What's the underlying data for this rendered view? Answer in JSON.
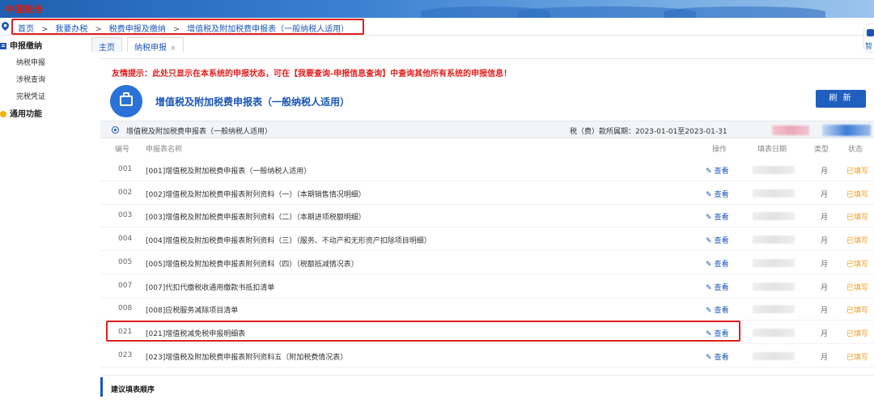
{
  "app": {
    "logo_text": "中国税务"
  },
  "breadcrumb": {
    "items": [
      "首页",
      "我要办税",
      "税费申报及缴纳",
      "增值税及附加税费申报表（一般纳税人适用）"
    ],
    "sep": ">"
  },
  "sidebar": {
    "section1": "申报缴纳",
    "items": [
      "纳税申报",
      "涉税查询",
      "完税凭证"
    ],
    "section2": "通用功能"
  },
  "tabs": [
    {
      "label": "主页"
    },
    {
      "label": "纳税申报",
      "close": "×"
    }
  ],
  "right_float": {
    "label": "智"
  },
  "main": {
    "tip": "友情提示：此处只显示在本系统的申报状态，可在【我要查询-申报信息查询】中查询其他所有系统的申报信息！",
    "form_title": "增值税及附加税费申报表（一般纳税人适用）",
    "refresh_label": "刷 新",
    "section_name": "增值税及附加税费申报表（一般纳税人适用）",
    "period_label": "税（费）款所属期：2023-01-01至2023-01-31",
    "columns": {
      "no": "编号",
      "name": "申报表名称",
      "op": "操作",
      "date": "填表日期",
      "type": "类型",
      "status": "状态"
    },
    "rows": [
      {
        "no": "001",
        "name": "[001]增值税及附加税费申报表（一般纳税人适用）",
        "op": "查看",
        "type": "月",
        "status": "已填写"
      },
      {
        "no": "002",
        "name": "[002]增值税及附加税费申报表附列资料（一）（本期销售情况明细）",
        "op": "查看",
        "type": "月",
        "status": "已填写"
      },
      {
        "no": "003",
        "name": "[003]增值税及附加税费申报表附列资料（二）（本期进项税额明细）",
        "op": "查看",
        "type": "月",
        "status": "已填写"
      },
      {
        "no": "004",
        "name": "[004]增值税及附加税费申报表附列资料（三）（服务、不动产和无形资产扣除项目明细）",
        "op": "查看",
        "type": "月",
        "status": "已填写"
      },
      {
        "no": "005",
        "name": "[005]增值税及附加税费申报表附列资料（四）（税额抵减情况表）",
        "op": "查看",
        "type": "月",
        "status": "已填写"
      },
      {
        "no": "007",
        "name": "[007]代扣代缴税收通用缴款书抵扣清单",
        "op": "查看",
        "type": "月",
        "status": "已填写"
      },
      {
        "no": "008",
        "name": "[008]应税服务减除项目清单",
        "op": "查看",
        "type": "月",
        "status": "已填写"
      },
      {
        "no": "021",
        "name": "[021]增值税减免税申报明细表",
        "op": "查看",
        "type": "月",
        "status": "已填写"
      },
      {
        "no": "023",
        "name": "[023]增值税及附加税费申报表附列资料五（附加税费情况表）",
        "op": "查看",
        "type": "月",
        "status": "已填写"
      }
    ],
    "suggest_title": "建议填表顺序"
  },
  "colors": {
    "accent": "#1a56b8",
    "alert": "#e02020",
    "status": "#f39a1e"
  }
}
